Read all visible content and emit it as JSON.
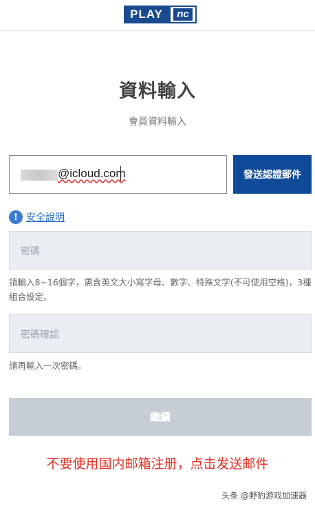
{
  "header": {
    "logo_play": "PLAY",
    "logo_nc": "nc"
  },
  "page": {
    "title": "資料輸入",
    "subtitle": "會員資料輸入"
  },
  "email": {
    "value": "@icloud.com"
  },
  "send_button": {
    "label": "發送認證郵件"
  },
  "security": {
    "icon": "info-icon",
    "label": "安全說明"
  },
  "password": {
    "placeholder": "密碼",
    "help": "請輸入8~16個字，需含英文大小寫字母、數字、特殊文字(不可使用空格)，3種組合設定。"
  },
  "password_confirm": {
    "placeholder": "密碼確認",
    "help": "請再輸入一次密碼。"
  },
  "continue_button": {
    "label": "繼續"
  },
  "annotation": {
    "text": "不要使用国内邮箱注册，点击发送邮件"
  },
  "watermark": {
    "text": "头条 @野豹游戏加速器"
  },
  "colors": {
    "brand": "#0f4a99",
    "annotation": "#e03024",
    "disabled": "#c7cdd4"
  }
}
